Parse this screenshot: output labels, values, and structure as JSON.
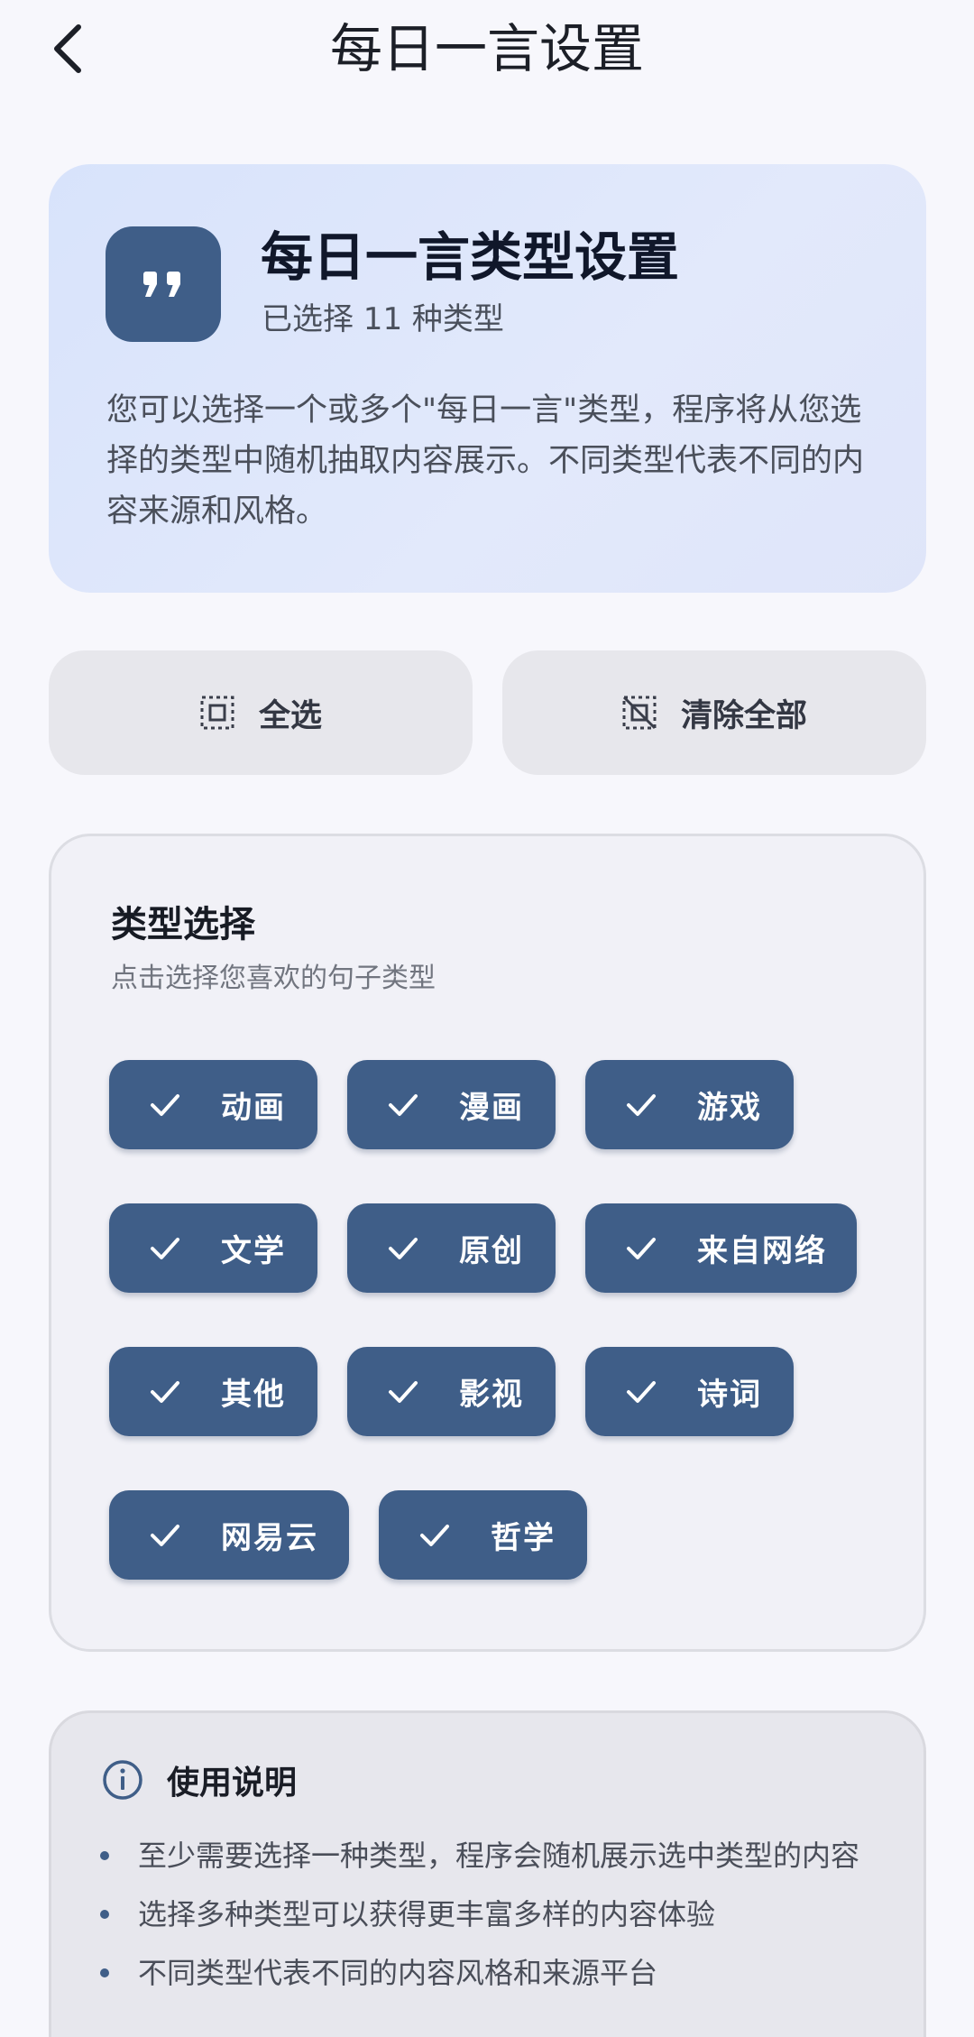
{
  "header": {
    "title": "每日一言设置",
    "back_icon": "chevron-left-icon"
  },
  "hero": {
    "icon": "format-quote-icon",
    "title": "每日一言类型设置",
    "subtitle": "已选择 11 种类型",
    "description": "您可以选择一个或多个\"每日一言\"类型，程序将从您选择的类型中随机抽取内容展示。不同类型代表不同的内容来源和风格。"
  },
  "actions": {
    "select_all": {
      "label": "全选",
      "icon": "select-all-icon"
    },
    "clear_all": {
      "label": "清除全部",
      "icon": "deselect-icon"
    }
  },
  "types": {
    "title": "类型选择",
    "subtitle": "点击选择您喜欢的句子类型",
    "chips": [
      {
        "label": "动画",
        "selected": true
      },
      {
        "label": "漫画",
        "selected": true
      },
      {
        "label": "游戏",
        "selected": true
      },
      {
        "label": "文学",
        "selected": true
      },
      {
        "label": "原创",
        "selected": true
      },
      {
        "label": "来自网络",
        "selected": true
      },
      {
        "label": "其他",
        "selected": true
      },
      {
        "label": "影视",
        "selected": true
      },
      {
        "label": "诗词",
        "selected": true
      },
      {
        "label": "网易云",
        "selected": true
      },
      {
        "label": "哲学",
        "selected": true
      }
    ]
  },
  "usage": {
    "icon": "info-icon",
    "title": "使用说明",
    "items": [
      "至少需要选择一种类型，程序会随机展示选中类型的内容",
      "选择多种类型可以获得更丰富多样的内容体验",
      "不同类型代表不同的内容风格和来源平台"
    ]
  },
  "colors": {
    "accent": "#3f5e88",
    "hero_bg": "#dce5fb",
    "page_bg": "#f7f7fc"
  }
}
